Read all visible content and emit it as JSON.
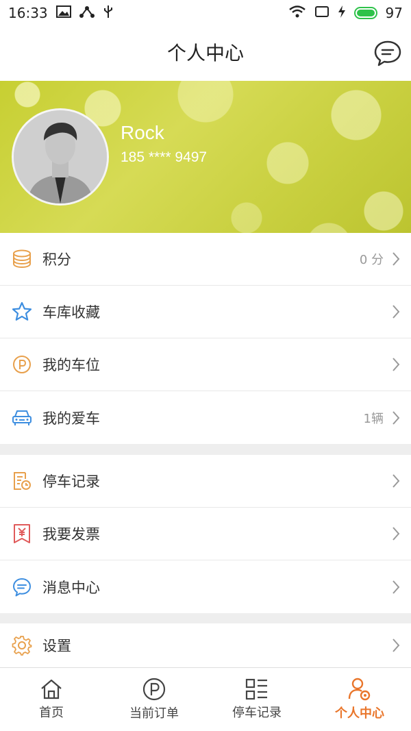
{
  "status_bar": {
    "time": "16:33",
    "battery_level": "97"
  },
  "header": {
    "title": "个人中心"
  },
  "profile": {
    "name": "Rock",
    "phone": "185 **** 9497"
  },
  "menu_groups": [
    [
      {
        "label": "积分",
        "value": "0 分",
        "icon": "coins-icon"
      },
      {
        "label": "车库收藏",
        "value": "",
        "icon": "star-icon"
      },
      {
        "label": "我的车位",
        "value": "",
        "icon": "parking-icon"
      },
      {
        "label": "我的爱车",
        "value": "1辆",
        "icon": "car-icon"
      }
    ],
    [
      {
        "label": "停车记录",
        "icon": "parking-record-icon"
      },
      {
        "label": "我要发票",
        "icon": "invoice-icon"
      },
      {
        "label": "消息中心",
        "icon": "message-icon"
      }
    ],
    [
      {
        "label": "设置",
        "icon": "gear-icon"
      }
    ]
  ],
  "tabs": [
    {
      "label": "首页",
      "icon": "home-icon",
      "active": false
    },
    {
      "label": "当前订单",
      "icon": "parking-icon",
      "active": false
    },
    {
      "label": "停车记录",
      "icon": "grid-list-icon",
      "active": false
    },
    {
      "label": "个人中心",
      "icon": "user-settings-icon",
      "active": true
    }
  ],
  "colors": {
    "accent": "#e9752a",
    "orange_icon": "#e8a04c",
    "blue_icon": "#3d8ee0",
    "red_icon": "#e05a5a"
  }
}
